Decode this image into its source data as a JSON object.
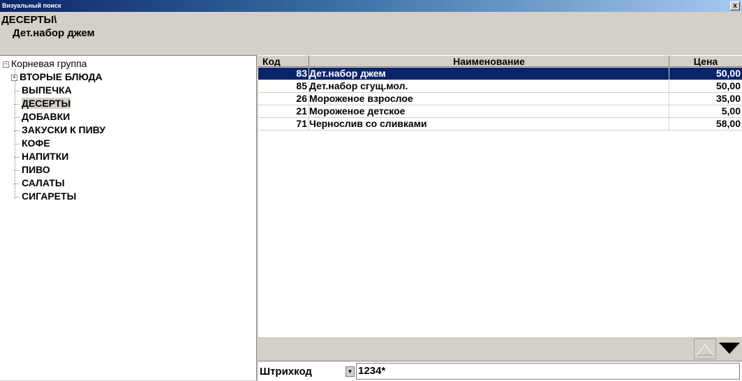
{
  "window": {
    "title": "Визуальный поиск",
    "close_label": "x"
  },
  "breadcrumb": {
    "path": "ДЕСЕРТЫ\\",
    "selected": "Дет.набор джем"
  },
  "tree": {
    "root_expander": "−",
    "root": "Корневая группа",
    "children": [
      {
        "label": "ВТОРЫЕ БЛЮДА",
        "expander": "+"
      },
      {
        "label": "ВЫПЕЧКА"
      },
      {
        "label": "ДЕСЕРТЫ"
      },
      {
        "label": "ДОБАВКИ"
      },
      {
        "label": "ЗАКУСКИ К ПИВУ"
      },
      {
        "label": "КОФЕ"
      },
      {
        "label": "НАПИТКИ"
      },
      {
        "label": "ПИВО"
      },
      {
        "label": "САЛАТЫ"
      },
      {
        "label": "СИГАРЕТЫ"
      }
    ]
  },
  "grid": {
    "headers": {
      "code": "Код",
      "name": "Наименование",
      "price": "Цена"
    },
    "rows": [
      {
        "code": "83",
        "name": "Дет.набор джем",
        "price": "50,00"
      },
      {
        "code": "85",
        "name": "Дет.набор сгущ.мол.",
        "price": "50,00"
      },
      {
        "code": "26",
        "name": "Мороженое взрослое",
        "price": "35,00"
      },
      {
        "code": "21",
        "name": "Мороженое детское",
        "price": "5,00"
      },
      {
        "code": "71",
        "name": "Чернослив со сливками",
        "price": "58,00"
      }
    ]
  },
  "search": {
    "type": "Штрихкод",
    "value": "1234*"
  },
  "colors": {
    "selection": "#0a246a",
    "face": "#d4d0c8"
  }
}
